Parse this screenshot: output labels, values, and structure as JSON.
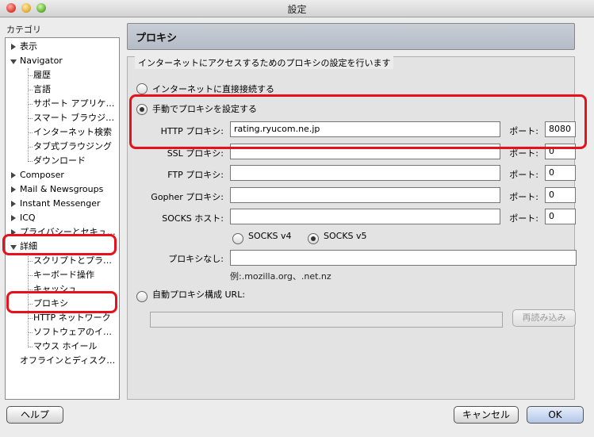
{
  "window": {
    "title": "設定"
  },
  "sidebar": {
    "header": "カテゴリ",
    "items": [
      {
        "label": "表示",
        "level": 0,
        "twisty": "right"
      },
      {
        "label": "Navigator",
        "level": 0,
        "twisty": "down"
      },
      {
        "label": "履歴",
        "level": 1
      },
      {
        "label": "言語",
        "level": 1
      },
      {
        "label": "サポート アプリケ…",
        "level": 1
      },
      {
        "label": "スマート ブラウジ…",
        "level": 1
      },
      {
        "label": "インターネット検索",
        "level": 1
      },
      {
        "label": "タブ式ブラウジング",
        "level": 1
      },
      {
        "label": "ダウンロード",
        "level": 1
      },
      {
        "label": "Composer",
        "level": 0,
        "twisty": "right"
      },
      {
        "label": "Mail & Newsgroups",
        "level": 0,
        "twisty": "right"
      },
      {
        "label": "Instant Messenger",
        "level": 0,
        "twisty": "right"
      },
      {
        "label": "ICQ",
        "level": 0,
        "twisty": "right"
      },
      {
        "label": "プライバシーとセキュ…",
        "level": 0,
        "twisty": "right"
      },
      {
        "label": "詳細",
        "level": 0,
        "twisty": "down"
      },
      {
        "label": "スクリプトとプラ…",
        "level": 1
      },
      {
        "label": "キーボード操作",
        "level": 1
      },
      {
        "label": "キャッシュ",
        "level": 1
      },
      {
        "label": "プロキシ",
        "level": 1,
        "selected": true
      },
      {
        "label": "HTTP ネットワーク",
        "level": 1
      },
      {
        "label": "ソフトウェアのイ…",
        "level": 1
      },
      {
        "label": "マウス ホイール",
        "level": 1
      },
      {
        "label": "オフラインとディスク…",
        "level": 0
      }
    ]
  },
  "panel": {
    "title": "プロキシ",
    "group_caption": "インターネットにアクセスするためのプロキシの設定を行います",
    "options": {
      "direct": "インターネットに直接接続する",
      "manual": "手動でプロキシを設定する",
      "auto": "自動プロキシ構成 URL:"
    },
    "selected_option": "manual",
    "proxies": [
      {
        "label": "HTTP プロキシ:",
        "host": "rating.ryucom.ne.jp",
        "port_label": "ポート:",
        "port": "8080"
      },
      {
        "label": "SSL プロキシ:",
        "host": "",
        "port_label": "ポート:",
        "port": "0"
      },
      {
        "label": "FTP プロキシ:",
        "host": "",
        "port_label": "ポート:",
        "port": "0"
      },
      {
        "label": "Gopher プロキシ:",
        "host": "",
        "port_label": "ポート:",
        "port": "0"
      },
      {
        "label": "SOCKS ホスト:",
        "host": "",
        "port_label": "ポート:",
        "port": "0"
      }
    ],
    "socks_v4": "SOCKS v4",
    "socks_v5": "SOCKS v5",
    "socks_selected": "v5",
    "no_proxy_label": "プロキシなし:",
    "no_proxy_value": "",
    "no_proxy_example": "例:.mozilla.org、.net.nz",
    "auto_url_value": "",
    "reload_button": "再読み込み"
  },
  "footer": {
    "help_button": "ヘルプ",
    "cancel_button": "キャンセル",
    "ok_button": "OK"
  },
  "annotation_color": "#e8101a"
}
